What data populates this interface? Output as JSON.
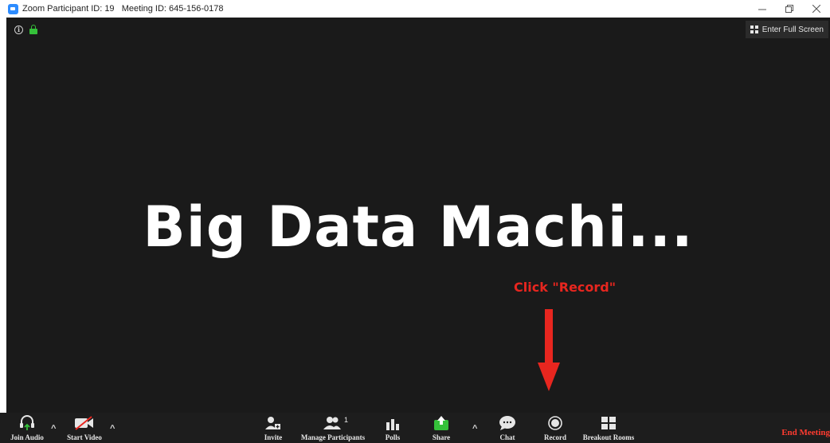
{
  "window": {
    "title": "Zoom Participant ID: 19   Meeting ID: 645-156-0178",
    "controls": [
      "minimize-icon",
      "restore-icon",
      "close-icon"
    ]
  },
  "meeting": {
    "fullscreen_label": "Enter Full Screen",
    "shared_title": "Big Data Machi...",
    "annotation": "Click \"Record\""
  },
  "toolbar": {
    "join_audio": "Join Audio",
    "start_video": "Start Video",
    "invite": "Invite",
    "manage_participants": "Manage Participants",
    "participant_count": "1",
    "polls": "Polls",
    "share": "Share",
    "chat": "Chat",
    "record": "Record",
    "breakout_rooms": "Breakout Rooms",
    "end_meeting": "End Meeting"
  },
  "colors": {
    "annotation": "#e8261f",
    "end_meeting": "#ff3b30",
    "share_green": "#35c13a",
    "lock_green": "#35c13a"
  }
}
